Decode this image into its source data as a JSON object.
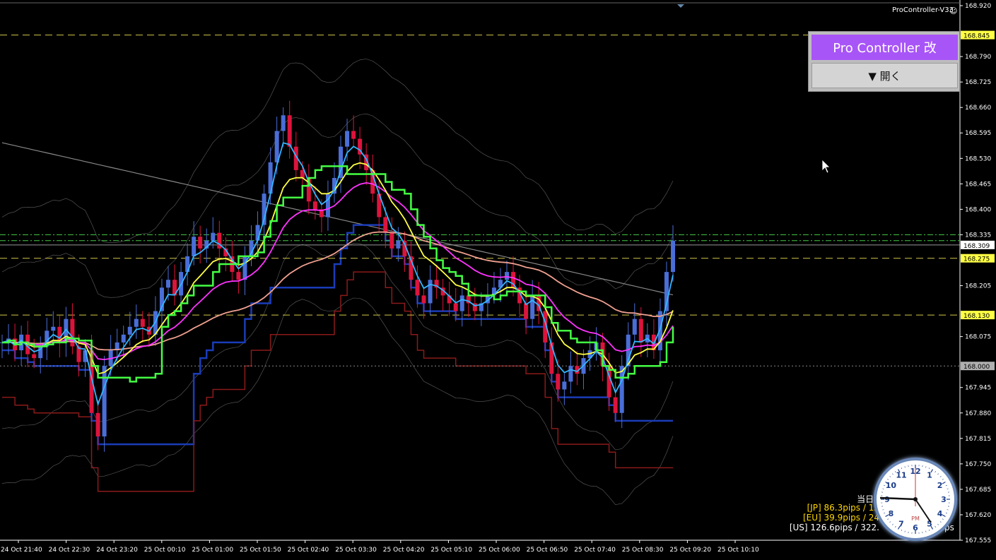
{
  "colors": {
    "background": "#000000",
    "axis": "#ffffff",
    "bull": "#4a6ed8",
    "bear": "#dc143c",
    "ema_fast": "#33b5ff",
    "ema_mid": "#ffff44",
    "ema_slow": "#ff33ff",
    "ichimoku": "#44ff44",
    "sma_long": "#f0a090",
    "channel_high": "#8b1a1a",
    "channel_low": "#1a3cb8",
    "band": "#a0a0a0",
    "level_line": "#d4c84a",
    "green_dash": "#44cc44"
  },
  "indicator_label": "ProController-V33",
  "panel": {
    "title": "Pro Controller 改",
    "button": "▼ 開く"
  },
  "pips_lines": [
    {
      "text": "[",
      "color": "#ffffff"
    },
    {
      "text": "当日 /",
      "color": "#ffffff"
    },
    {
      "text": "[JP] 86.3pips / 12",
      "color": "#ffd700"
    },
    {
      "text": "[EU] 39.9pips / 24",
      "color": "#ffd700"
    },
    {
      "text": "[US] 126.6pips / 322.",
      "color": "#ffffff"
    }
  ],
  "pips_suffix": "ps",
  "clock": {
    "label": "PM",
    "hour_hand": "4:5",
    "min_hand": "45"
  },
  "chart_data": {
    "type": "candlestick",
    "symbol": "",
    "y_axis": {
      "min": 167.555,
      "max": 168.92,
      "ticks": [
        "168.920",
        "168.790",
        "168.725",
        "168.660",
        "168.595",
        "168.530",
        "168.465",
        "168.400",
        "168.335",
        "168.205",
        "168.075",
        "167.945",
        "167.880",
        "167.815",
        "167.750",
        "167.685",
        "167.620",
        "167.555"
      ]
    },
    "price_labels": [
      {
        "value": 168.845,
        "text": "168.845",
        "bg": "#ffff44"
      },
      {
        "value": 168.309,
        "text": "168.309",
        "bg": "#ffffff"
      },
      {
        "value": 168.275,
        "text": "168.275",
        "bg": "#ffff44"
      },
      {
        "value": 168.13,
        "text": "168.130",
        "bg": "#ffff44"
      },
      {
        "value": 168.0,
        "text": "168.000",
        "bg": "#b0b0b0"
      }
    ],
    "x_axis": {
      "ticks": [
        "24 Oct 21:40",
        "24 Oct 22:30",
        "24 Oct 23:20",
        "25 Oct 00:10",
        "25 Oct 01:00",
        "25 Oct 01:50",
        "25 Oct 02:40",
        "25 Oct 03:30",
        "25 Oct 04:20",
        "25 Oct 05:10",
        "25 Oct 06:00",
        "25 Oct 06:50",
        "25 Oct 07:40",
        "25 Oct 08:30",
        "25 Oct 09:20",
        "25 Oct 10:10"
      ]
    },
    "close_trend": [
      168.06,
      168.07,
      168.04,
      168.08,
      168.03,
      168.02,
      168.05,
      168.09,
      168.1,
      168.06,
      168.12,
      168.05,
      168.01,
      168.04,
      167.88,
      167.82,
      168.0,
      168.04,
      168.06,
      168.08,
      168.1,
      168.12,
      168.1,
      168.08,
      168.14,
      168.2,
      168.22,
      168.18,
      168.24,
      168.28,
      168.33,
      168.3,
      168.32,
      168.34,
      168.3,
      168.28,
      168.24,
      168.22,
      168.28,
      168.32,
      168.36,
      168.44,
      168.52,
      168.6,
      168.64,
      168.56,
      168.5,
      168.48,
      168.42,
      168.4,
      168.38,
      168.44,
      168.48,
      168.56,
      168.6,
      168.58,
      168.54,
      168.5,
      168.44,
      168.38,
      168.34,
      168.3,
      168.32,
      168.28,
      168.22,
      168.18,
      168.16,
      168.22,
      168.2,
      168.18,
      168.16,
      168.14,
      168.18,
      168.16,
      168.14,
      168.16,
      168.18,
      168.2,
      168.22,
      168.24,
      168.2,
      168.16,
      168.12,
      168.18,
      168.14,
      168.06,
      167.98,
      167.94,
      167.96,
      168.0,
      167.98,
      168.02,
      168.04,
      168.06,
      168.0,
      167.92,
      167.88,
      168.0,
      168.08,
      168.12,
      168.06,
      168.08,
      168.04,
      168.14,
      168.24,
      168.32
    ]
  }
}
